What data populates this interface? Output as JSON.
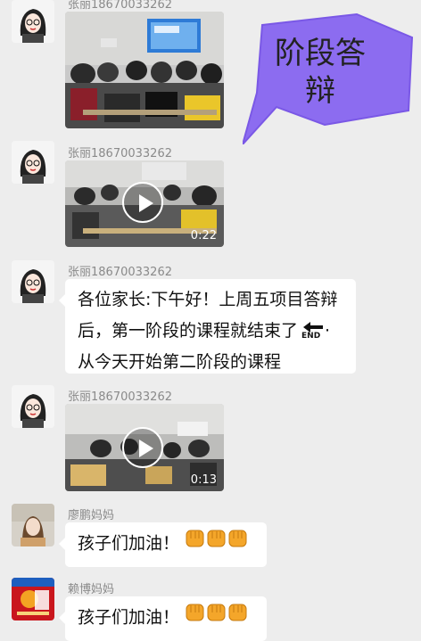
{
  "overlay_sticker": {
    "text_line1": "阶段答",
    "text_line2": "辩",
    "color": "#8c6cf0"
  },
  "messages": [
    {
      "sender": "张丽18670033262",
      "type": "image"
    },
    {
      "sender": "张丽18670033262",
      "type": "video",
      "duration": "0:22"
    },
    {
      "sender": "张丽18670033262",
      "type": "text",
      "line1": "各位家长:下午好！上周五项目答辩",
      "line2": "后，第一阶段的课程就结束了",
      "line2_suffix": "END",
      "line2_tail": "·",
      "line3": "从今天开始第二阶段的课程"
    },
    {
      "sender": "张丽18670033262",
      "type": "video",
      "duration": "0:13"
    },
    {
      "sender": "廖鹏妈妈",
      "type": "text",
      "text": "孩子们加油！",
      "emoji": "fist"
    },
    {
      "sender": "赖博妈妈",
      "type": "text",
      "text": "孩子们加油！",
      "emoji": "fist"
    }
  ],
  "colors": {
    "background": "#ededed",
    "bubble": "#ffffff",
    "sender_name": "#8a8a8a",
    "emoji_fist": "#f4a62a"
  }
}
